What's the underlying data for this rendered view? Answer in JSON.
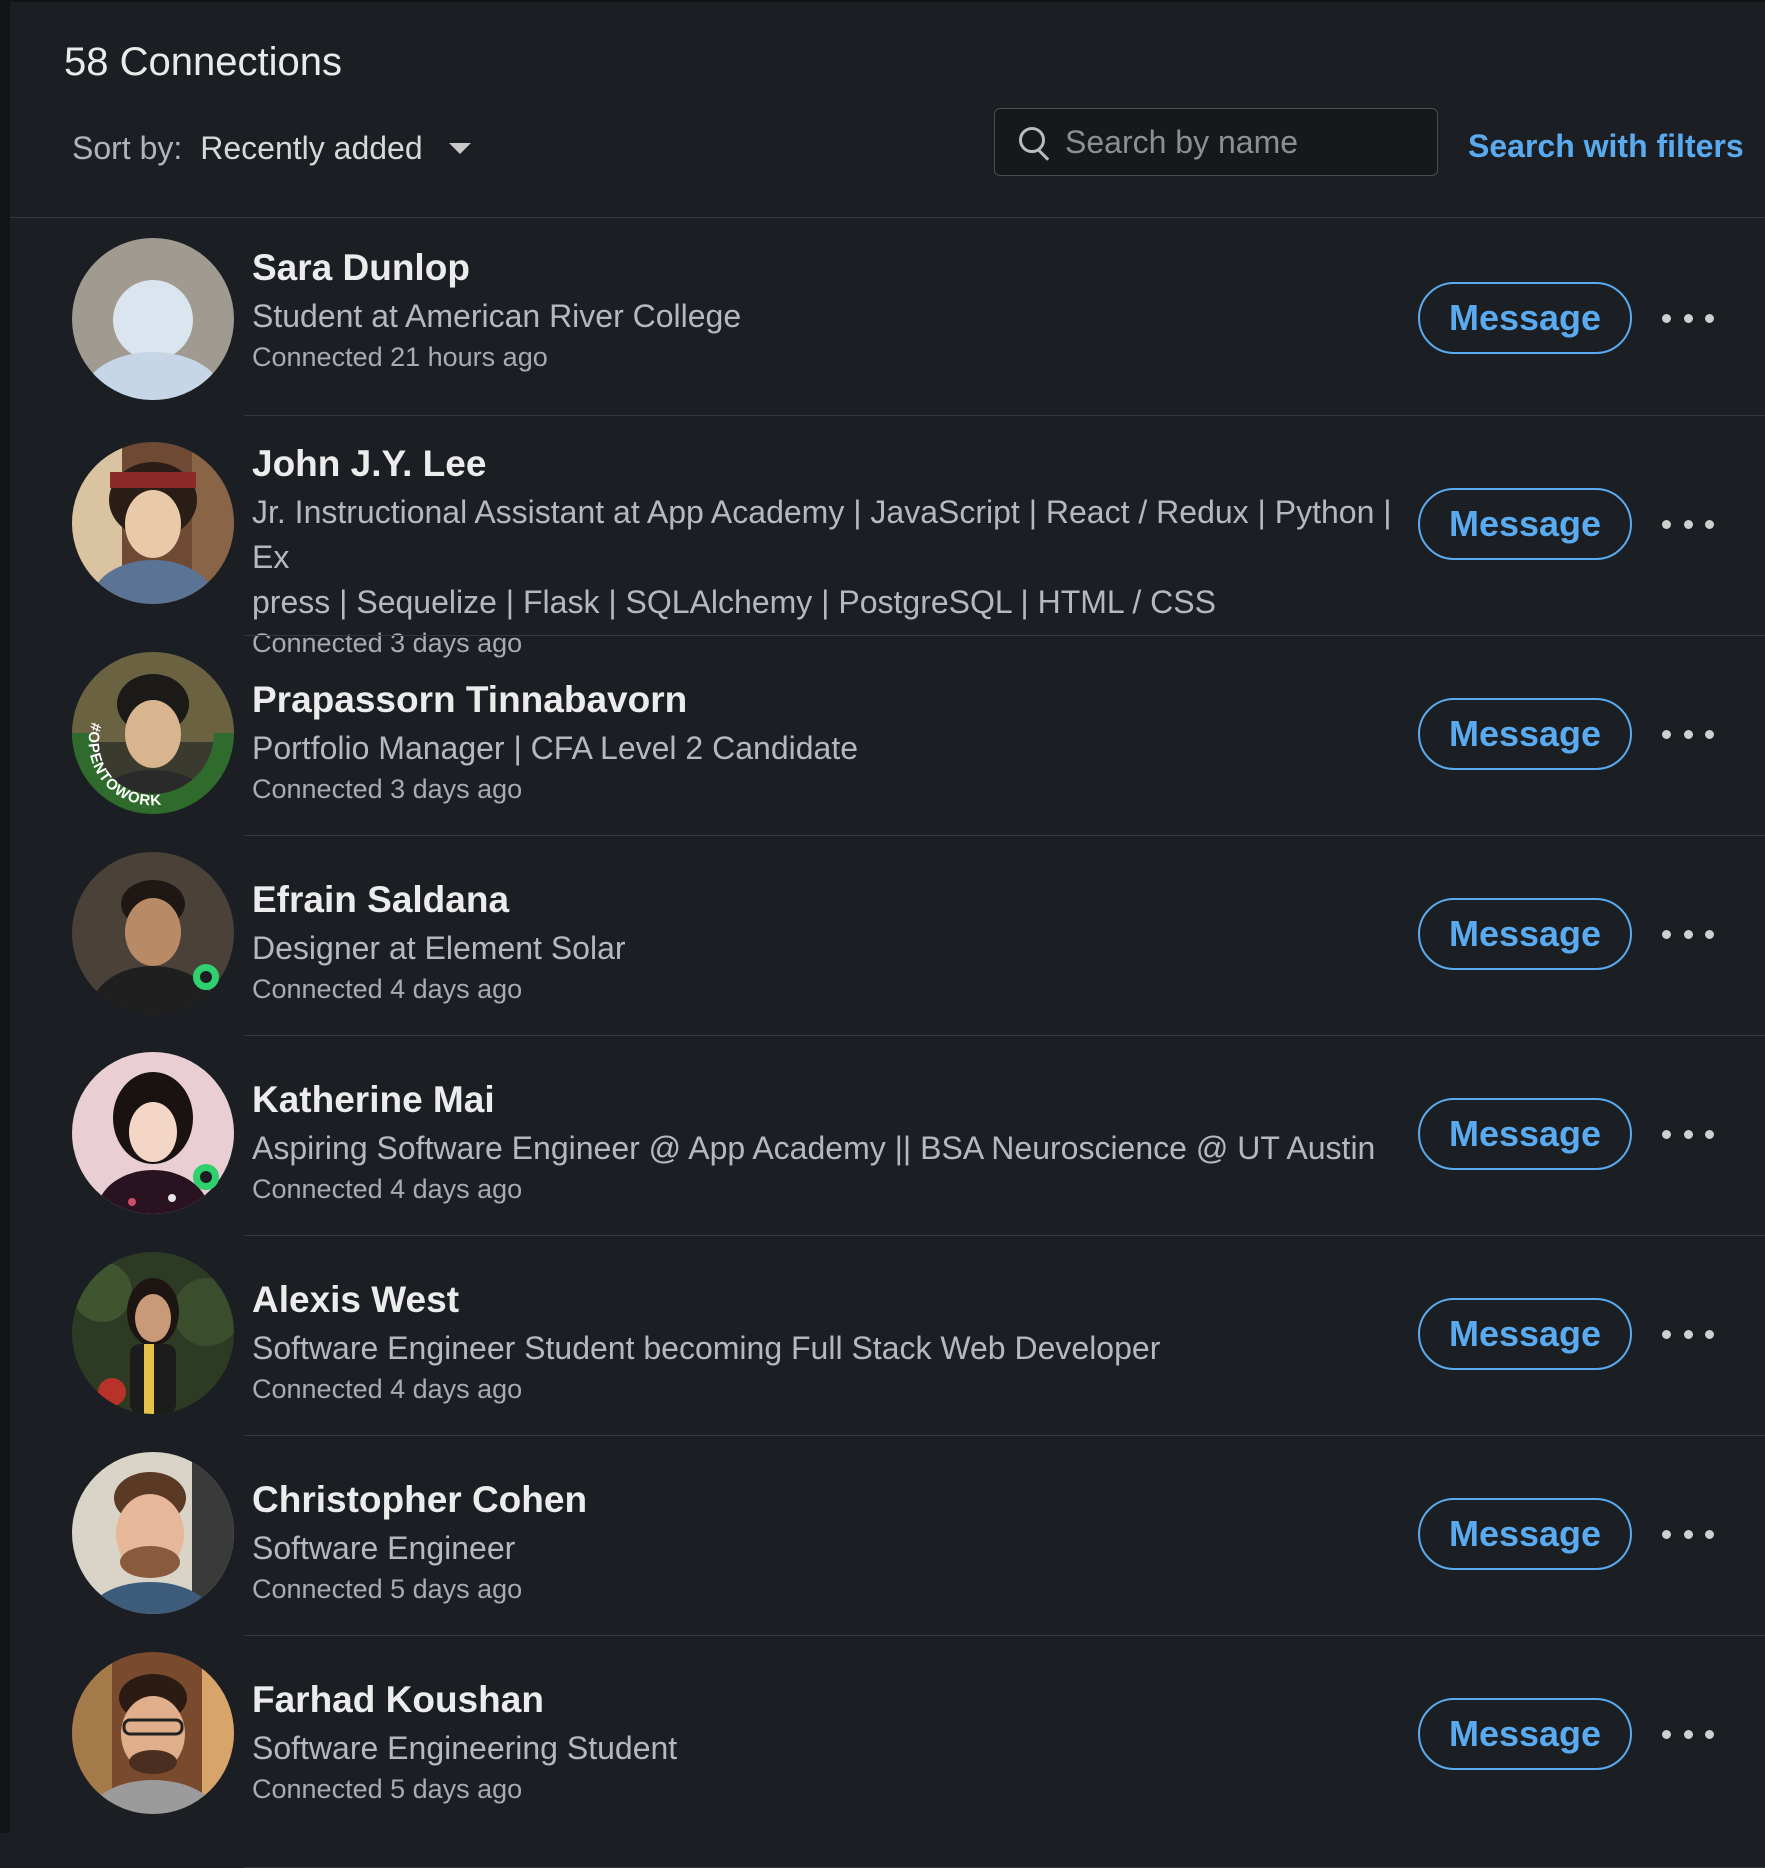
{
  "header": {
    "title": "58 Connections",
    "sort_label": "Sort by:",
    "sort_value": "Recently added",
    "search_placeholder": "Search by name",
    "filters_link": "Search with filters"
  },
  "colors": {
    "background": "#1b1f23",
    "accent": "#5aaaf0",
    "online": "#2fd06d"
  },
  "connections": [
    {
      "name": "Sara Dunlop",
      "headline": "Student at American River College",
      "time": "Connected 21 hours ago",
      "online": false,
      "message_label": "Message"
    },
    {
      "name": "John J.Y. Lee",
      "headline": "Jr. Instructional Assistant at App Academy | JavaScript | React / Redux | Python | Ex",
      "headline2": "press | Sequelize | Flask | SQLAlchemy | PostgreSQL | HTML / CSS",
      "time": "Connected 3 days ago",
      "online": false,
      "message_label": "Message"
    },
    {
      "name": "Prapassorn Tinnabavorn",
      "headline": "Portfolio Manager | CFA Level 2 Candidate",
      "time": "Connected 3 days ago",
      "online": false,
      "open_to_work": "#OPENTOWORK",
      "message_label": "Message"
    },
    {
      "name": "Efrain Saldana",
      "headline": "Designer at Element Solar",
      "time": "Connected 4 days ago",
      "online": true,
      "message_label": "Message"
    },
    {
      "name": "Katherine Mai",
      "headline": "Aspiring Software Engineer @ App Academy || BSA Neuroscience @ UT Austin",
      "time": "Connected 4 days ago",
      "online": true,
      "message_label": "Message"
    },
    {
      "name": "Alexis West",
      "headline": "Software Engineer Student becoming Full Stack Web Developer",
      "time": "Connected 4 days ago",
      "online": false,
      "message_label": "Message"
    },
    {
      "name": "Christopher Cohen",
      "headline": "Software Engineer",
      "time": "Connected 5 days ago",
      "online": false,
      "message_label": "Message"
    },
    {
      "name": "Farhad Koushan",
      "headline": "Software Engineering Student",
      "time": "Connected 5 days ago",
      "online": false,
      "message_label": "Message"
    }
  ]
}
